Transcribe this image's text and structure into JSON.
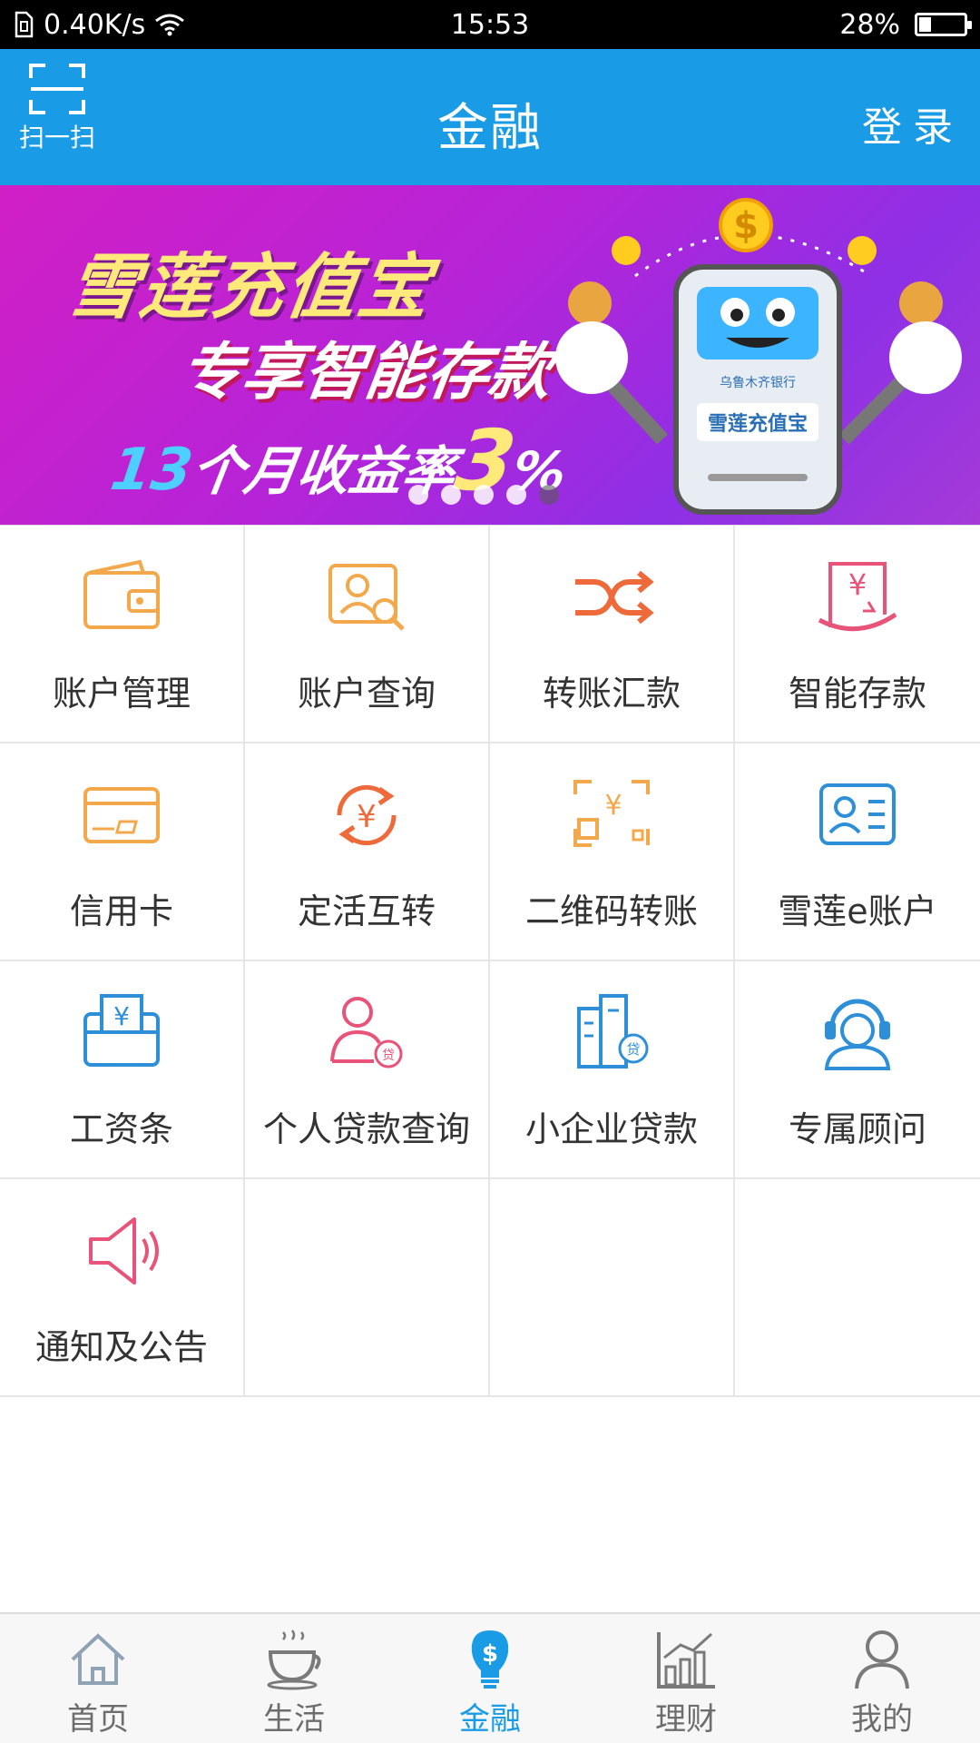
{
  "status_bar": {
    "speed": "0.40K/s",
    "time": "15:53",
    "battery": "28%",
    "battery_level": 0.28
  },
  "header": {
    "scan_label": "扫一扫",
    "title": "金融",
    "login": "登录"
  },
  "banner": {
    "line1": "雪莲充值宝",
    "line2": "专享智能存款",
    "line3_num": "13",
    "line3_text": "个月收益率",
    "line3_rate": "3",
    "line3_percent": "%",
    "mascot_text": "雪莲充值宝",
    "bank_name": "乌鲁木齐银行",
    "slide_count": 5,
    "active_slide": 4
  },
  "grid": {
    "items": [
      {
        "label": "账户管理",
        "icon": "wallet-icon",
        "color": "#f3a84b"
      },
      {
        "label": "账户查询",
        "icon": "account-search-icon",
        "color": "#f3a84b"
      },
      {
        "label": "转账汇款",
        "icon": "shuffle-transfer-icon",
        "color": "#ef6a3a"
      },
      {
        "label": "智能存款",
        "icon": "smart-deposit-icon",
        "color": "#e8537a"
      },
      {
        "label": "信用卡",
        "icon": "credit-card-icon",
        "color": "#f3a84b"
      },
      {
        "label": "定活互转",
        "icon": "yuan-cycle-icon",
        "color": "#ef6a3a"
      },
      {
        "label": "二维码转账",
        "icon": "qr-transfer-icon",
        "color": "#f3a84b"
      },
      {
        "label": "雪莲e账户",
        "icon": "id-card-icon",
        "color": "#2e8fd9"
      },
      {
        "label": "工资条",
        "icon": "payslip-icon",
        "color": "#2e8fd9"
      },
      {
        "label": "个人贷款查询",
        "icon": "personal-loan-icon",
        "color": "#e8537a"
      },
      {
        "label": "小企业贷款",
        "icon": "business-loan-icon",
        "color": "#2e8fd9"
      },
      {
        "label": "专属顾问",
        "icon": "advisor-headset-icon",
        "color": "#2e8fd9"
      },
      {
        "label": "通知及公告",
        "icon": "megaphone-icon",
        "color": "#e8537a"
      }
    ]
  },
  "bottom_nav": {
    "items": [
      {
        "label": "首页",
        "icon": "home-icon"
      },
      {
        "label": "生活",
        "icon": "coffee-cup-icon"
      },
      {
        "label": "金融",
        "icon": "finance-bulb-icon"
      },
      {
        "label": "理财",
        "icon": "bar-chart-icon"
      },
      {
        "label": "我的",
        "icon": "person-icon"
      }
    ],
    "active_index": 2
  },
  "colors": {
    "primary": "#1a9be6",
    "orange": "#f3a84b",
    "red_orange": "#ef6a3a",
    "pink": "#e8537a",
    "blue": "#2e8fd9"
  }
}
